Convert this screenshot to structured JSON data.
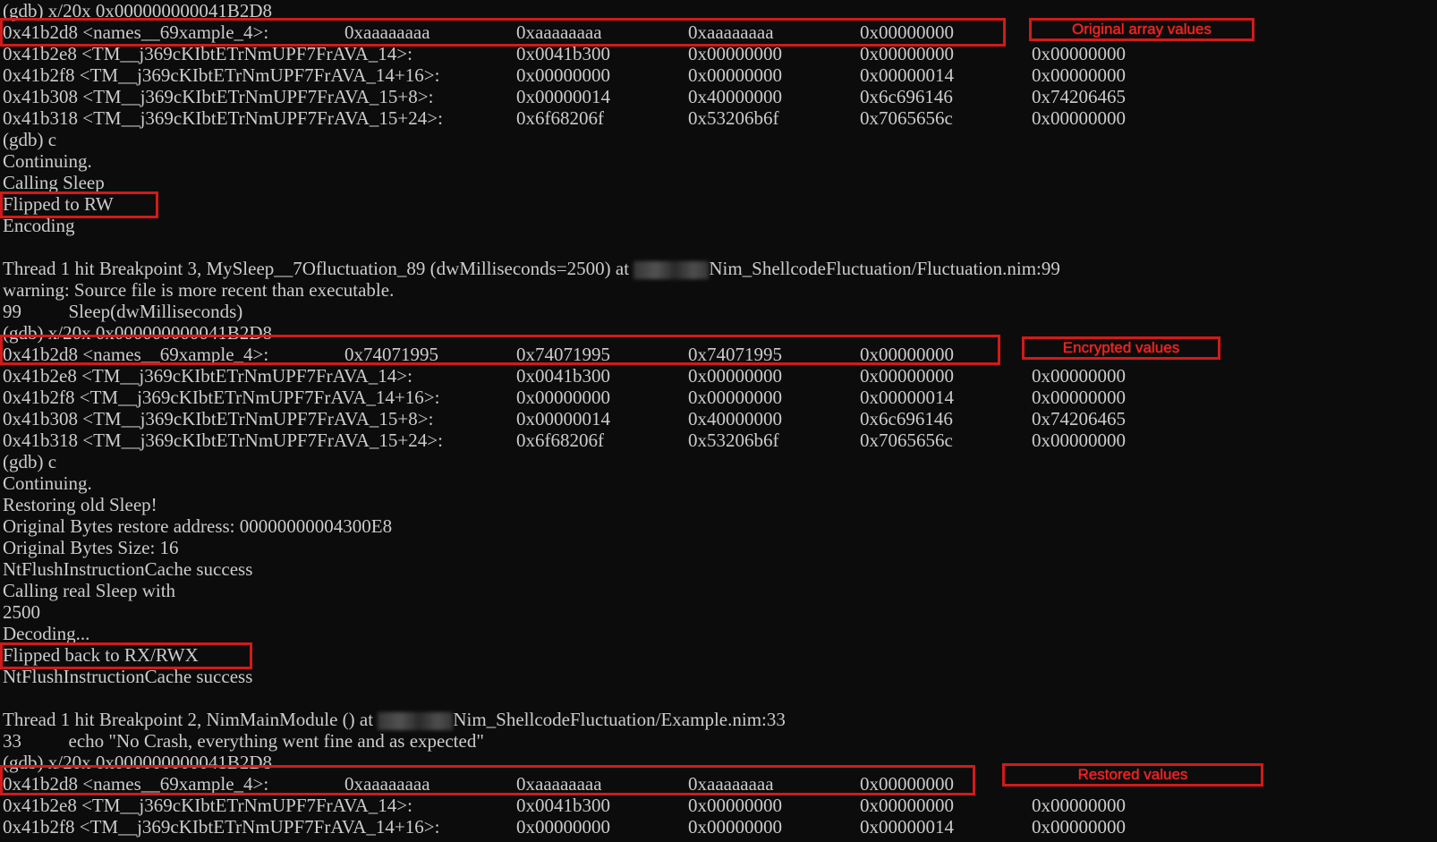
{
  "terminal": {
    "lines": [
      "(gdb) x/20x 0x000000000041B2D8",
      "",
      "",
      "",
      "",
      "",
      "(gdb) c",
      "Continuing.",
      "Calling Sleep",
      "Flipped to RW",
      "Encoding",
      "",
      "Thread 1 hit Breakpoint 3, MySleep__7Ofluctuation_89 (dwMilliseconds=2500) at ",
      "warning: Source file is more recent than executable.",
      "99          Sleep(dwMilliseconds)",
      "(gdb) x/20x 0x000000000041B2D8",
      "",
      "",
      "",
      "",
      "",
      "(gdb) c",
      "Continuing.",
      "Restoring old Sleep!",
      "Original Bytes restore address: 00000000004300E8",
      "Original Bytes Size: 16",
      "NtFlushInstructionCache success",
      "Calling real Sleep with",
      "2500",
      "Decoding...",
      "Flipped back to RX/RWX",
      "NtFlushInstructionCache success",
      "",
      "Thread 1 hit Breakpoint 2, NimMainModule () at ",
      "33          echo \"No Crash, everything went fine and as expected\"",
      "(gdb) x/20x 0x000000000041B2D8"
    ],
    "path_fluctuation": "Nim_ShellcodeFluctuation/Fluctuation.nim:99",
    "path_example": "Nim_ShellcodeFluctuation/Example.nim:33",
    "dumps": [
      {
        "rows": [
          {
            "addr": "0x41b2d8 <names__69xample_4>:",
            "vals": [
              "0xaaaaaaaa",
              "0xaaaaaaaa",
              "0xaaaaaaaa",
              "0x00000000"
            ]
          },
          {
            "addr": "0x41b2e8 <TM__j369cKIbtETrNmUPF7FrAVA_14>:",
            "vals": [
              "0x0041b300",
              "0x00000000",
              "0x00000000",
              "0x00000000"
            ]
          },
          {
            "addr": "0x41b2f8 <TM__j369cKIbtETrNmUPF7FrAVA_14+16>:",
            "vals": [
              "0x00000000",
              "0x00000000",
              "0x00000014",
              "0x00000000"
            ]
          },
          {
            "addr": "0x41b308 <TM__j369cKIbtETrNmUPF7FrAVA_15+8>:",
            "vals": [
              "0x00000014",
              "0x40000000",
              "0x6c696146",
              "0x74206465"
            ]
          },
          {
            "addr": "0x41b318 <TM__j369cKIbtETrNmUPF7FrAVA_15+24>:",
            "vals": [
              "0x6f68206f",
              "0x53206b6f",
              "0x7065656c",
              "0x00000000"
            ]
          }
        ]
      },
      {
        "rows": [
          {
            "addr": "0x41b2d8 <names__69xample_4>:",
            "vals": [
              "0x74071995",
              "0x74071995",
              "0x74071995",
              "0x00000000"
            ]
          },
          {
            "addr": "0x41b2e8 <TM__j369cKIbtETrNmUPF7FrAVA_14>:",
            "vals": [
              "0x0041b300",
              "0x00000000",
              "0x00000000",
              "0x00000000"
            ]
          },
          {
            "addr": "0x41b2f8 <TM__j369cKIbtETrNmUPF7FrAVA_14+16>:",
            "vals": [
              "0x00000000",
              "0x00000000",
              "0x00000014",
              "0x00000000"
            ]
          },
          {
            "addr": "0x41b308 <TM__j369cKIbtETrNmUPF7FrAVA_15+8>:",
            "vals": [
              "0x00000014",
              "0x40000000",
              "0x6c696146",
              "0x74206465"
            ]
          },
          {
            "addr": "0x41b318 <TM__j369cKIbtETrNmUPF7FrAVA_15+24>:",
            "vals": [
              "0x6f68206f",
              "0x53206b6f",
              "0x7065656c",
              "0x00000000"
            ]
          }
        ]
      },
      {
        "rows": [
          {
            "addr": "0x41b2d8 <names__69xample_4>:",
            "vals": [
              "0xaaaaaaaa",
              "0xaaaaaaaa",
              "0xaaaaaaaa",
              "0x00000000"
            ]
          },
          {
            "addr": "0x41b2e8 <TM__j369cKIbtETrNmUPF7FrAVA_14>:",
            "vals": [
              "0x0041b300",
              "0x00000000",
              "0x00000000",
              "0x00000000"
            ]
          },
          {
            "addr": "0x41b2f8 <TM__j369cKIbtETrNmUPF7FrAVA_14+16>:",
            "vals": [
              "0x00000000",
              "0x00000000",
              "0x00000014",
              "0x00000000"
            ]
          }
        ]
      }
    ]
  },
  "annotations": {
    "original": "Original array values",
    "encrypted": "Encrypted values",
    "restored": "Restored values"
  },
  "colors": {
    "background": "#0c0c0c",
    "text": "#cccccc",
    "annotation_red": "#d21a1a"
  }
}
